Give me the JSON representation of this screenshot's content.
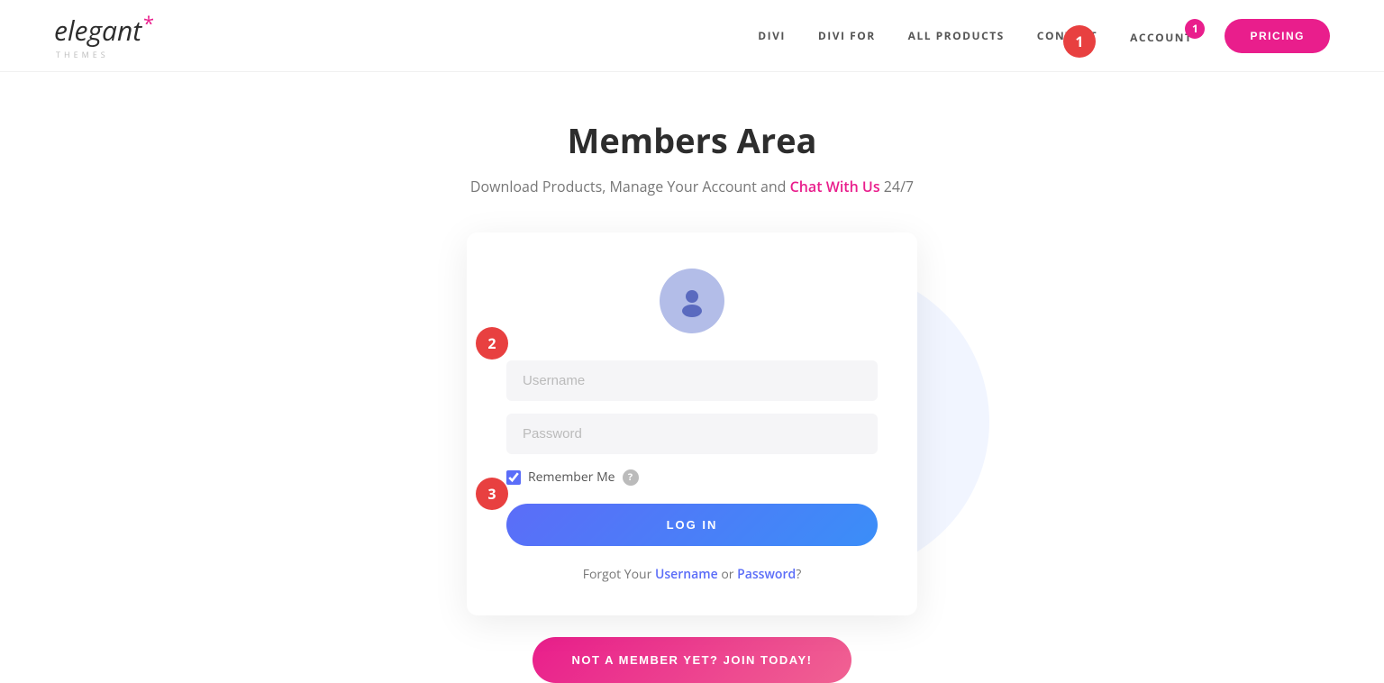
{
  "header": {
    "logo": {
      "main_text": "elegant",
      "asterisk": "*",
      "sub_text": "themes"
    },
    "nav": {
      "items": [
        {
          "label": "DIVI",
          "id": "divi"
        },
        {
          "label": "DIVI FOR",
          "id": "divi-for"
        },
        {
          "label": "ALL PRODUCTS",
          "id": "all-products"
        },
        {
          "label": "CONTACT",
          "id": "contact"
        },
        {
          "label": "ACCOUNT",
          "id": "account"
        }
      ],
      "account_badge": "1",
      "pricing_label": "PRICING"
    }
  },
  "hero": {
    "title": "Members Area",
    "subtitle_before": "Download Products, Manage Your Account and ",
    "subtitle_link": "Chat With Us",
    "subtitle_after": " 24/7"
  },
  "login_card": {
    "username_placeholder": "Username",
    "password_placeholder": "Password",
    "remember_label": "Remember Me",
    "login_button": "LOG IN",
    "forgot_prefix": "Forgot Your ",
    "forgot_username": "Username",
    "forgot_or": " or ",
    "forgot_password": "Password",
    "forgot_suffix": "?"
  },
  "join_section": {
    "button_label": "NOT A MEMBER YET? JOIN TODAY!"
  },
  "annotations": {
    "badge_1": "1",
    "badge_2": "2",
    "badge_3": "3"
  },
  "colors": {
    "pink": "#e91e8c",
    "blue": "#5b6df8",
    "red_badge": "#e84040"
  }
}
